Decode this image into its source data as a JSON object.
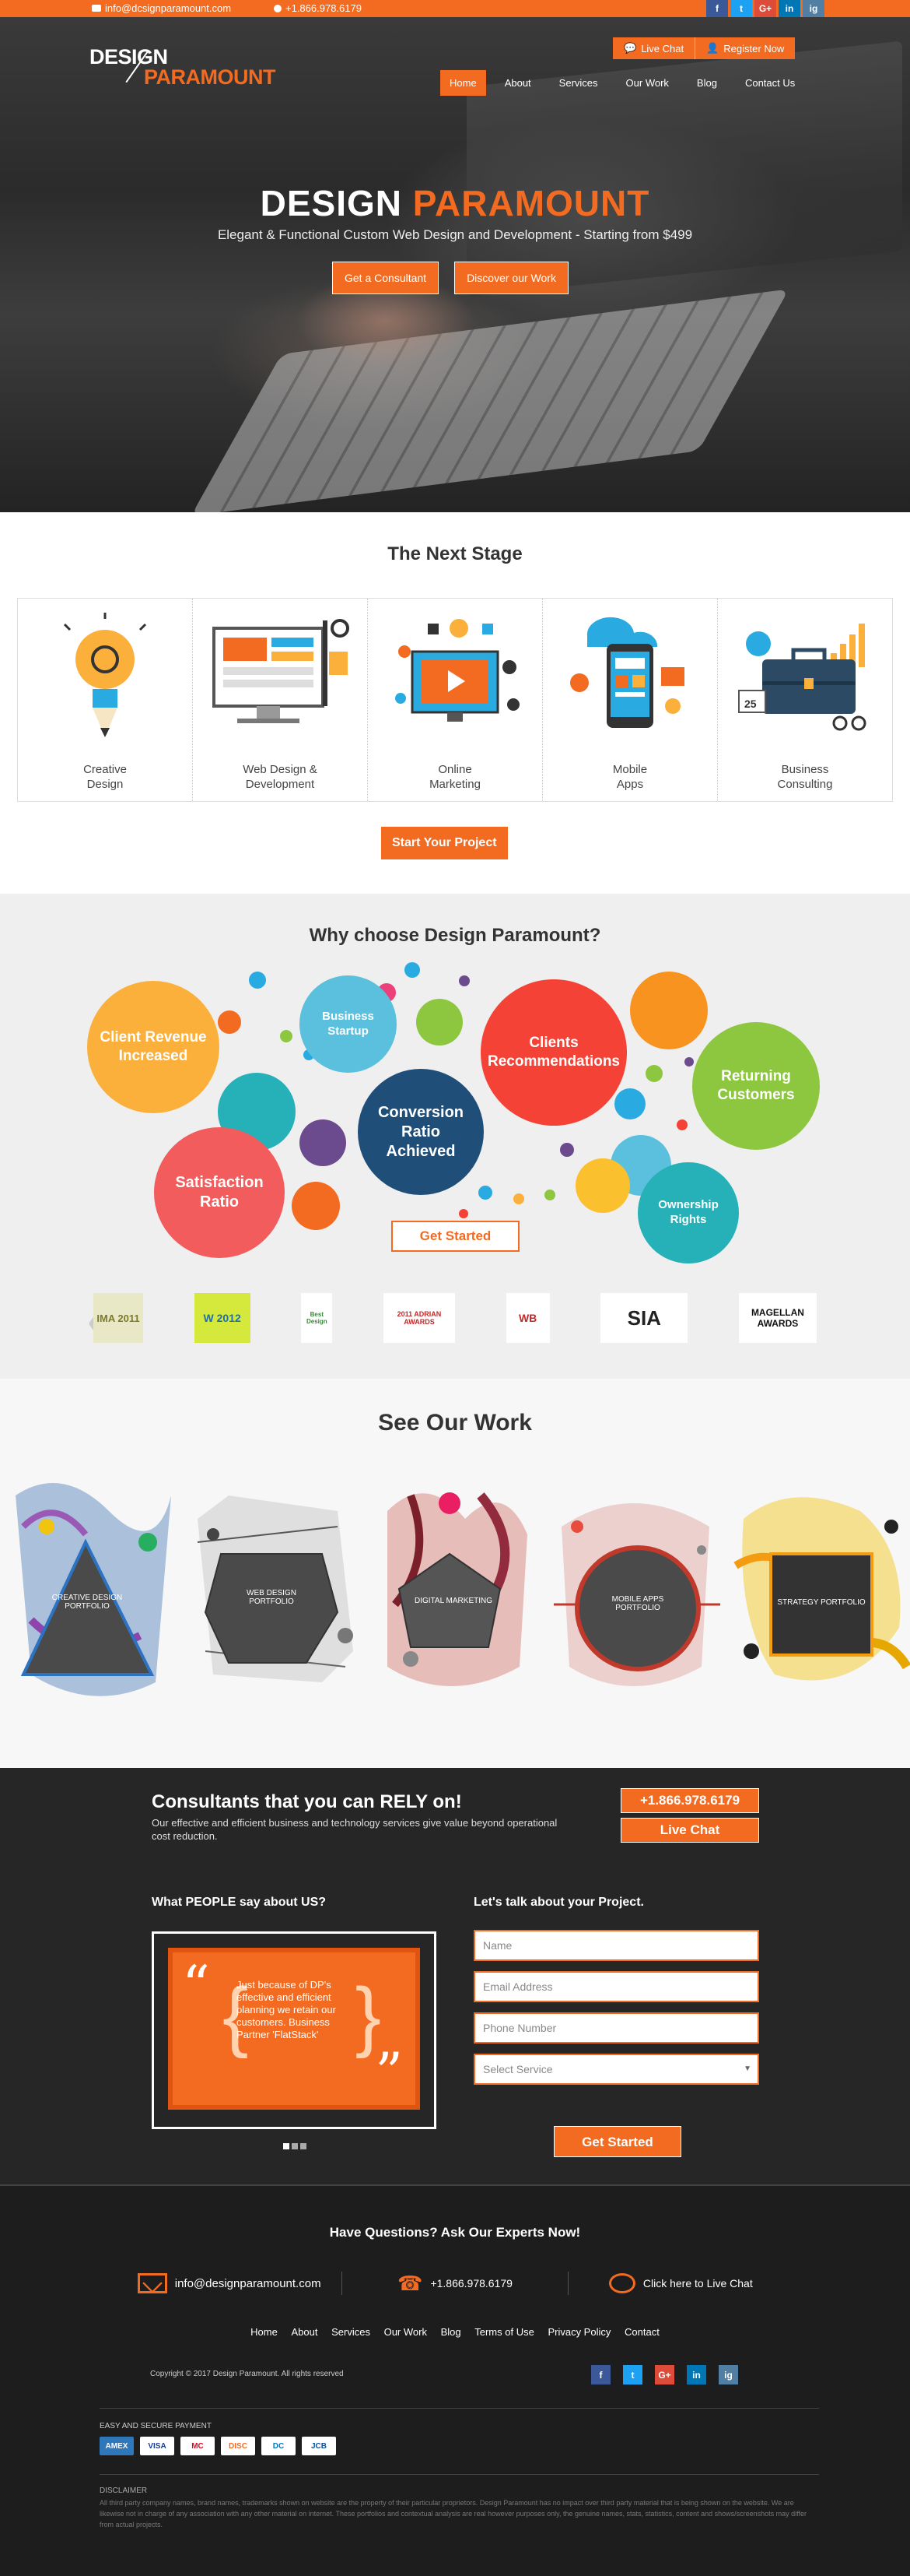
{
  "topbar": {
    "email": "info@dcsignparamount.com",
    "phone": "+1.866.978.6179",
    "social": [
      "f",
      "t",
      "G+",
      "in",
      "ig"
    ]
  },
  "header": {
    "logo_line1": "DESIGN",
    "logo_line2": "PARAMOUNT",
    "live_chat": "Live Chat",
    "register": "Register Now",
    "nav": [
      "Home",
      "About",
      "Services",
      "Our Work",
      "Blog",
      "Contact Us"
    ]
  },
  "hero": {
    "title_part1": "DESIGN",
    "title_part2": "PARAMOUNT",
    "subtitle": "Elegant & Functional Custom Web Design and Development - Starting from $499",
    "btn_consultant": "Get a Consultant",
    "btn_work": "Discover our Work"
  },
  "next_stage": {
    "title": "The Next Stage",
    "items": [
      {
        "line1": "Creative",
        "line2": "Design"
      },
      {
        "line1": "Web Design &",
        "line2": "Development"
      },
      {
        "line1": "Online",
        "line2": "Marketing"
      },
      {
        "line1": "Mobile",
        "line2": "Apps"
      },
      {
        "line1": "Business",
        "line2": "Consulting"
      }
    ],
    "button": "Start Your Project"
  },
  "why": {
    "title": "Why choose Design Paramount?",
    "bubbles": [
      "Client Revenue Increased",
      "Business Startup",
      "Clients Recommendations",
      "Returning Customers",
      "Conversion Ratio Achieved",
      "Satisfaction Ratio",
      "Ownership Rights"
    ],
    "button": "Get Started",
    "awards": [
      "IMA 2011",
      "W 2012",
      "Best Design",
      "2011 ADRIAN AWARDS",
      "WB",
      "SIA",
      "MAGELLAN AWARDS"
    ]
  },
  "work": {
    "title": "See Our Work",
    "items": [
      "Creative Design Portfolio",
      "Web Design Portfolio",
      "Digital Marketing",
      "Mobile Apps Portfolio",
      "Strategy Portfolio"
    ]
  },
  "consult": {
    "title": "Consultants that you can RELY on!",
    "subtitle": "Our effective and efficient business and technology services give value beyond operational cost reduction.",
    "phone": "+1.866.978.6179",
    "chat": "Live Chat",
    "say_title": "What PEOPLE say about US?",
    "testimonial": "Just because of DP's effective and efficient planning we retain our customers.  Business Partner 'FlatStack'",
    "talk_title": "Let's talk about your Project.",
    "placeholders": {
      "name": "Name",
      "email": "Email Address",
      "phone": "Phone Number",
      "service": "Select Service"
    },
    "submit": "Get Started"
  },
  "footer": {
    "ask": "Have Questions? Ask Our Experts Now!",
    "email": "info@designparamount.com",
    "phone": "+1.866.978.6179",
    "chat": "Click here to Live Chat",
    "nav": [
      "Home",
      "About",
      "Services",
      "Our Work",
      "Blog",
      "Terms of Use",
      "Privacy Policy",
      "Contact"
    ],
    "copyright": "Copyright © 2017 Design Paramount. All rights reserved",
    "social": [
      "f",
      "t",
      "G+",
      "in",
      "ig"
    ],
    "payment_title": "Easy and Secure Payment",
    "payments": [
      "AMEX",
      "VISA",
      "MC",
      "DISC",
      "DC",
      "JCB"
    ],
    "disclaimer_title": "Disclaimer",
    "disclaimer": "All third party company names, brand names, trademarks shown on website are the property of their particular proprietors. Design Paramount has no impact over third party material that is being shown on the website. We are likewise not in charge of any association with any other material on internet. These portfolios and contextual analysis are real however purposes only, the genuine names, stats, statistics, content and shows/screenshots may differ from actual projects."
  },
  "colors": {
    "accent": "#f26b21",
    "dark": "#262626"
  }
}
